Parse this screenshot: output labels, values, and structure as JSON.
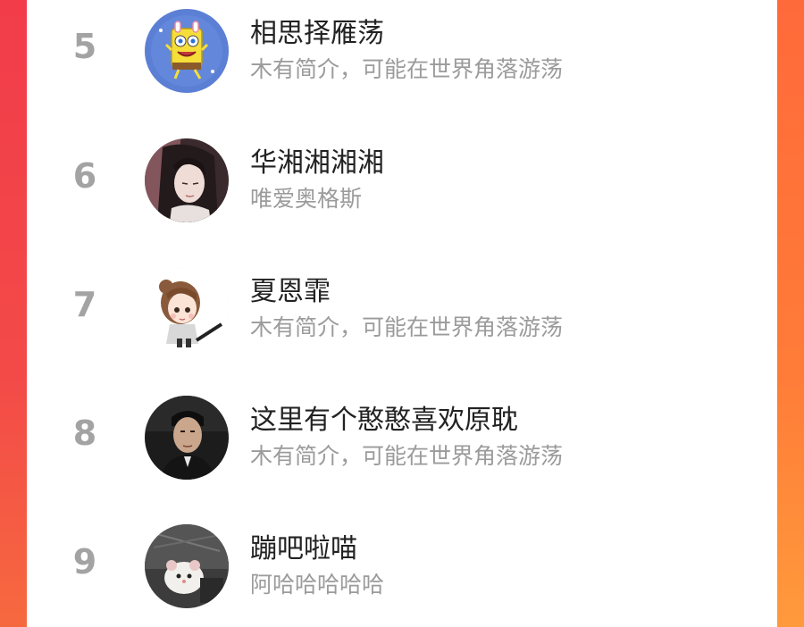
{
  "ranking": [
    {
      "rank": "5",
      "name": "相思择雁荡",
      "bio": "木有简介，可能在世界角落游荡",
      "avatar_icon": "spongebob-avatar"
    },
    {
      "rank": "6",
      "name": "华湘湘湘湘",
      "bio": "唯爱奥格斯",
      "avatar_icon": "anime-character-avatar"
    },
    {
      "rank": "7",
      "name": "夏恩霏",
      "bio": "木有简介，可能在世界角落游荡",
      "avatar_icon": "chibi-girl-avatar"
    },
    {
      "rank": "8",
      "name": "这里有个憨憨喜欢原耽",
      "bio": "木有简介，可能在世界角落游荡",
      "avatar_icon": "man-photo-avatar"
    },
    {
      "rank": "9",
      "name": "蹦吧啦喵",
      "bio": "阿哈哈哈哈哈",
      "avatar_icon": "hamster-photo-avatar"
    }
  ],
  "colors": {
    "rank": "#a3a3a3",
    "name": "#222222",
    "bio": "#9b9b9b",
    "background_top": "#f8484a",
    "background_bottom": "#ff9a3c"
  }
}
